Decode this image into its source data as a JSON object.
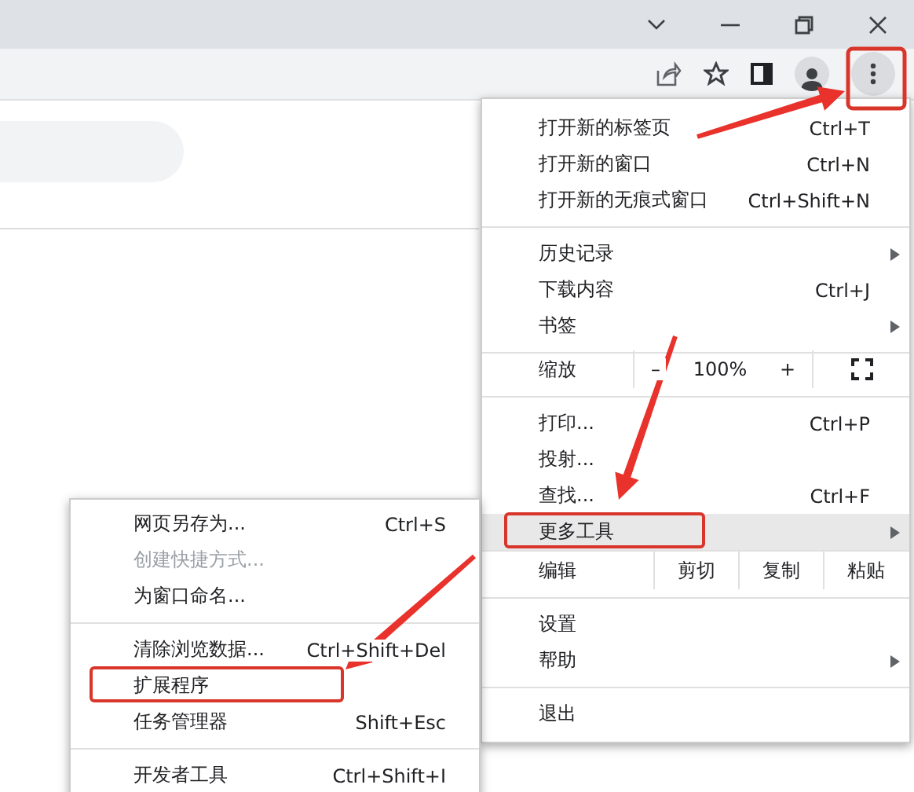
{
  "menu": {
    "items": [
      {
        "kind": "item",
        "label": "打开新的标签页",
        "shortcut": "Ctrl+T",
        "submenu": false,
        "highlighted": false,
        "annotated": false
      },
      {
        "kind": "item",
        "label": "打开新的窗口",
        "shortcut": "Ctrl+N",
        "submenu": false,
        "highlighted": false,
        "annotated": false
      },
      {
        "kind": "item",
        "label": "打开新的无痕式窗口",
        "shortcut": "Ctrl+Shift+N",
        "submenu": false,
        "highlighted": false,
        "annotated": false
      },
      {
        "kind": "separator"
      },
      {
        "kind": "item",
        "label": "历史记录",
        "submenu": true,
        "highlighted": false,
        "annotated": false
      },
      {
        "kind": "item",
        "label": "下载内容",
        "shortcut": "Ctrl+J",
        "submenu": false,
        "highlighted": false,
        "annotated": false
      },
      {
        "kind": "item",
        "label": "书签",
        "submenu": true,
        "highlighted": false,
        "annotated": false
      },
      {
        "kind": "separator"
      },
      {
        "kind": "zoom",
        "label": "缩放",
        "decrease": "–",
        "value": "100%",
        "increase": "+"
      },
      {
        "kind": "separator"
      },
      {
        "kind": "item",
        "label": "打印...",
        "shortcut": "Ctrl+P",
        "submenu": false,
        "highlighted": false,
        "annotated": false
      },
      {
        "kind": "item",
        "label": "投射...",
        "submenu": false,
        "highlighted": false,
        "annotated": false
      },
      {
        "kind": "item",
        "label": "查找...",
        "shortcut": "Ctrl+F",
        "submenu": false,
        "highlighted": false,
        "annotated": false
      },
      {
        "kind": "item",
        "label": "更多工具",
        "submenu": true,
        "highlighted": true,
        "annotated": true
      },
      {
        "kind": "edit",
        "label": "编辑",
        "actions": [
          "剪切",
          "复制",
          "粘贴"
        ]
      },
      {
        "kind": "separator"
      },
      {
        "kind": "item",
        "label": "设置",
        "submenu": false,
        "highlighted": false,
        "annotated": false
      },
      {
        "kind": "item",
        "label": "帮助",
        "submenu": true,
        "highlighted": false,
        "annotated": false
      },
      {
        "kind": "separator"
      },
      {
        "kind": "item",
        "label": "退出",
        "submenu": false,
        "highlighted": false,
        "annotated": false
      }
    ]
  },
  "submenu": {
    "items": [
      {
        "kind": "item",
        "label": "网页另存为...",
        "shortcut": "Ctrl+S",
        "disabled": false,
        "annotated": false
      },
      {
        "kind": "item",
        "label": "创建快捷方式...",
        "disabled": true,
        "annotated": false
      },
      {
        "kind": "item",
        "label": "为窗口命名...",
        "disabled": false,
        "annotated": false
      },
      {
        "kind": "separator"
      },
      {
        "kind": "item",
        "label": "清除浏览数据...",
        "shortcut": "Ctrl+Shift+Del",
        "disabled": false,
        "annotated": false
      },
      {
        "kind": "item",
        "label": "扩展程序",
        "disabled": false,
        "annotated": true
      },
      {
        "kind": "item",
        "label": "任务管理器",
        "shortcut": "Shift+Esc",
        "disabled": false,
        "annotated": false
      },
      {
        "kind": "separator"
      },
      {
        "kind": "item",
        "label": "开发者工具",
        "shortcut": "Ctrl+Shift+I",
        "disabled": false,
        "annotated": false
      }
    ]
  }
}
